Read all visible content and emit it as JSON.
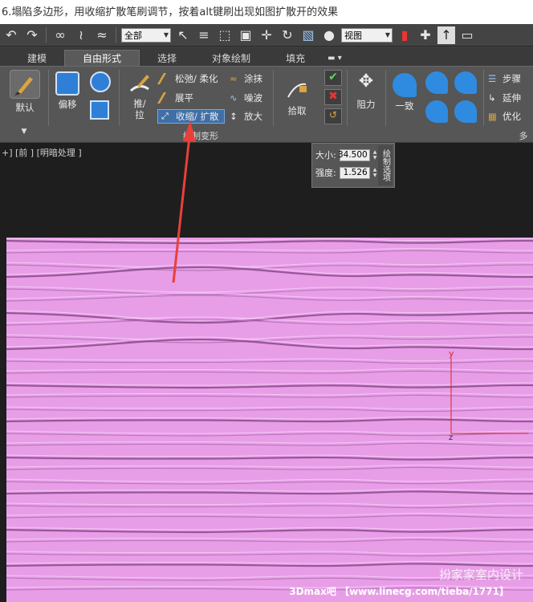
{
  "caption": "6.塌陷多边形，用收缩扩散笔刷调节，按着alt键刷出现如图扩散开的效果",
  "main_toolbar": {
    "selection_filter": "全部",
    "reference_coord": "视图",
    "icons": [
      "undo-icon",
      "redo-icon",
      "link-icon",
      "unlink-icon",
      "bind-spacewarp-icon",
      "select-object-icon",
      "select-by-name-icon",
      "rect-region-icon",
      "window-crossing-icon",
      "move-icon",
      "rotate-icon",
      "scale-icon",
      "pivot-icon",
      "snap-icon",
      "mirror-icon"
    ]
  },
  "ribbon_tabs": [
    "建模",
    "自由形式",
    "选择",
    "对象绘制",
    "填充"
  ],
  "active_tab": "自由形式",
  "ribbon": {
    "default_label": "默认",
    "offset_label": "偏移",
    "push_pull_label": "推/\n拉",
    "relax_soften": "松弛/ 柔化",
    "flatten": "展平",
    "shrink_expand": "收缩/ 扩散",
    "smudge": "涂抹",
    "noise": "噪波",
    "inflate": "放大",
    "pick_label": "拾取",
    "constrain_label": "阻力",
    "conform_label": "一致",
    "step_label": "步骤",
    "extend_label": "延伸",
    "optimize_label": "优化",
    "group_label": "绘制变形",
    "more_label": "多"
  },
  "popup": {
    "title": "绘制选项",
    "size_label": "大小:",
    "size_value": "34.500",
    "strength_label": "强度:",
    "strength_value": "1.526"
  },
  "viewport": {
    "label": "+] [前 ] [明暗处理 ]",
    "axis_y": "y",
    "axis_z": "z",
    "watermark": "扮家家室内设计",
    "footer": "3Dmax吧 【www.linecg.com/tieba/1771】"
  },
  "colors": {
    "mesh": "#e79ee7",
    "highlight": "#3f6fa6",
    "arrow": "#e8413a"
  }
}
